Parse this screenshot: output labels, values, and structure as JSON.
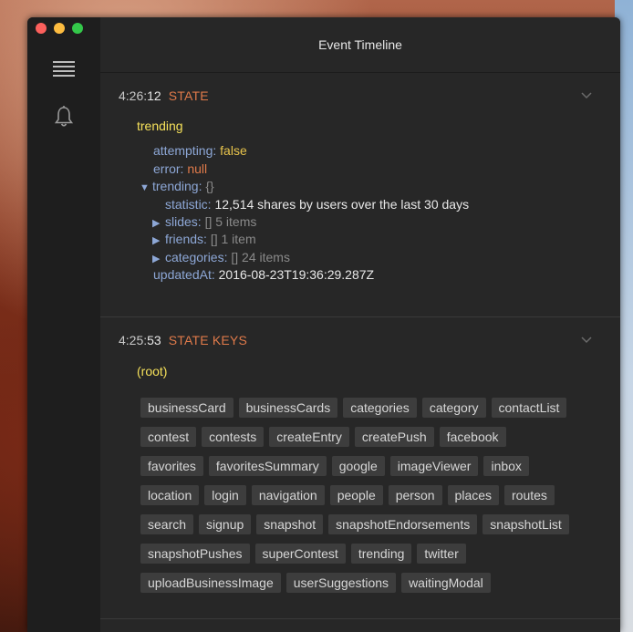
{
  "window": {
    "title": "Event Timeline"
  },
  "sidebar": {
    "items": [
      {
        "icon": "menu-icon"
      },
      {
        "icon": "bell-icon"
      }
    ]
  },
  "events": [
    {
      "time_prefix": "4:26:",
      "time_sec": "12",
      "type": "STATE",
      "root": "trending",
      "rows": {
        "attempting_key": "attempting:",
        "attempting_val": "false",
        "error_key": "error:",
        "error_val": "null",
        "trending_key": "trending:",
        "trending_val": "{}",
        "statistic_key": "statistic:",
        "statistic_val": "12,514 shares by users over the last 30 days",
        "slides_key": "slides:",
        "slides_br": "[]",
        "slides_count": "5 items",
        "friends_key": "friends:",
        "friends_br": "[]",
        "friends_count": "1 item",
        "categories_key": "categories:",
        "categories_br": "[]",
        "categories_count": "24 items",
        "updated_key": "updatedAt:",
        "updated_val": "2016-08-23T19:36:29.287Z"
      }
    },
    {
      "time_prefix": "4:25:",
      "time_sec": "53",
      "type": "STATE KEYS",
      "root": "(root)",
      "keys": [
        "businessCard",
        "businessCards",
        "categories",
        "category",
        "contactList",
        "contest",
        "contests",
        "createEntry",
        "createPush",
        "facebook",
        "favorites",
        "favoritesSummary",
        "google",
        "imageViewer",
        "inbox",
        "location",
        "login",
        "navigation",
        "people",
        "person",
        "places",
        "routes",
        "search",
        "signup",
        "snapshot",
        "snapshotEndorsements",
        "snapshotList",
        "snapshotPushes",
        "superContest",
        "trending",
        "twitter",
        "uploadBusinessImage",
        "userSuggestions",
        "waitingModal"
      ]
    }
  ]
}
